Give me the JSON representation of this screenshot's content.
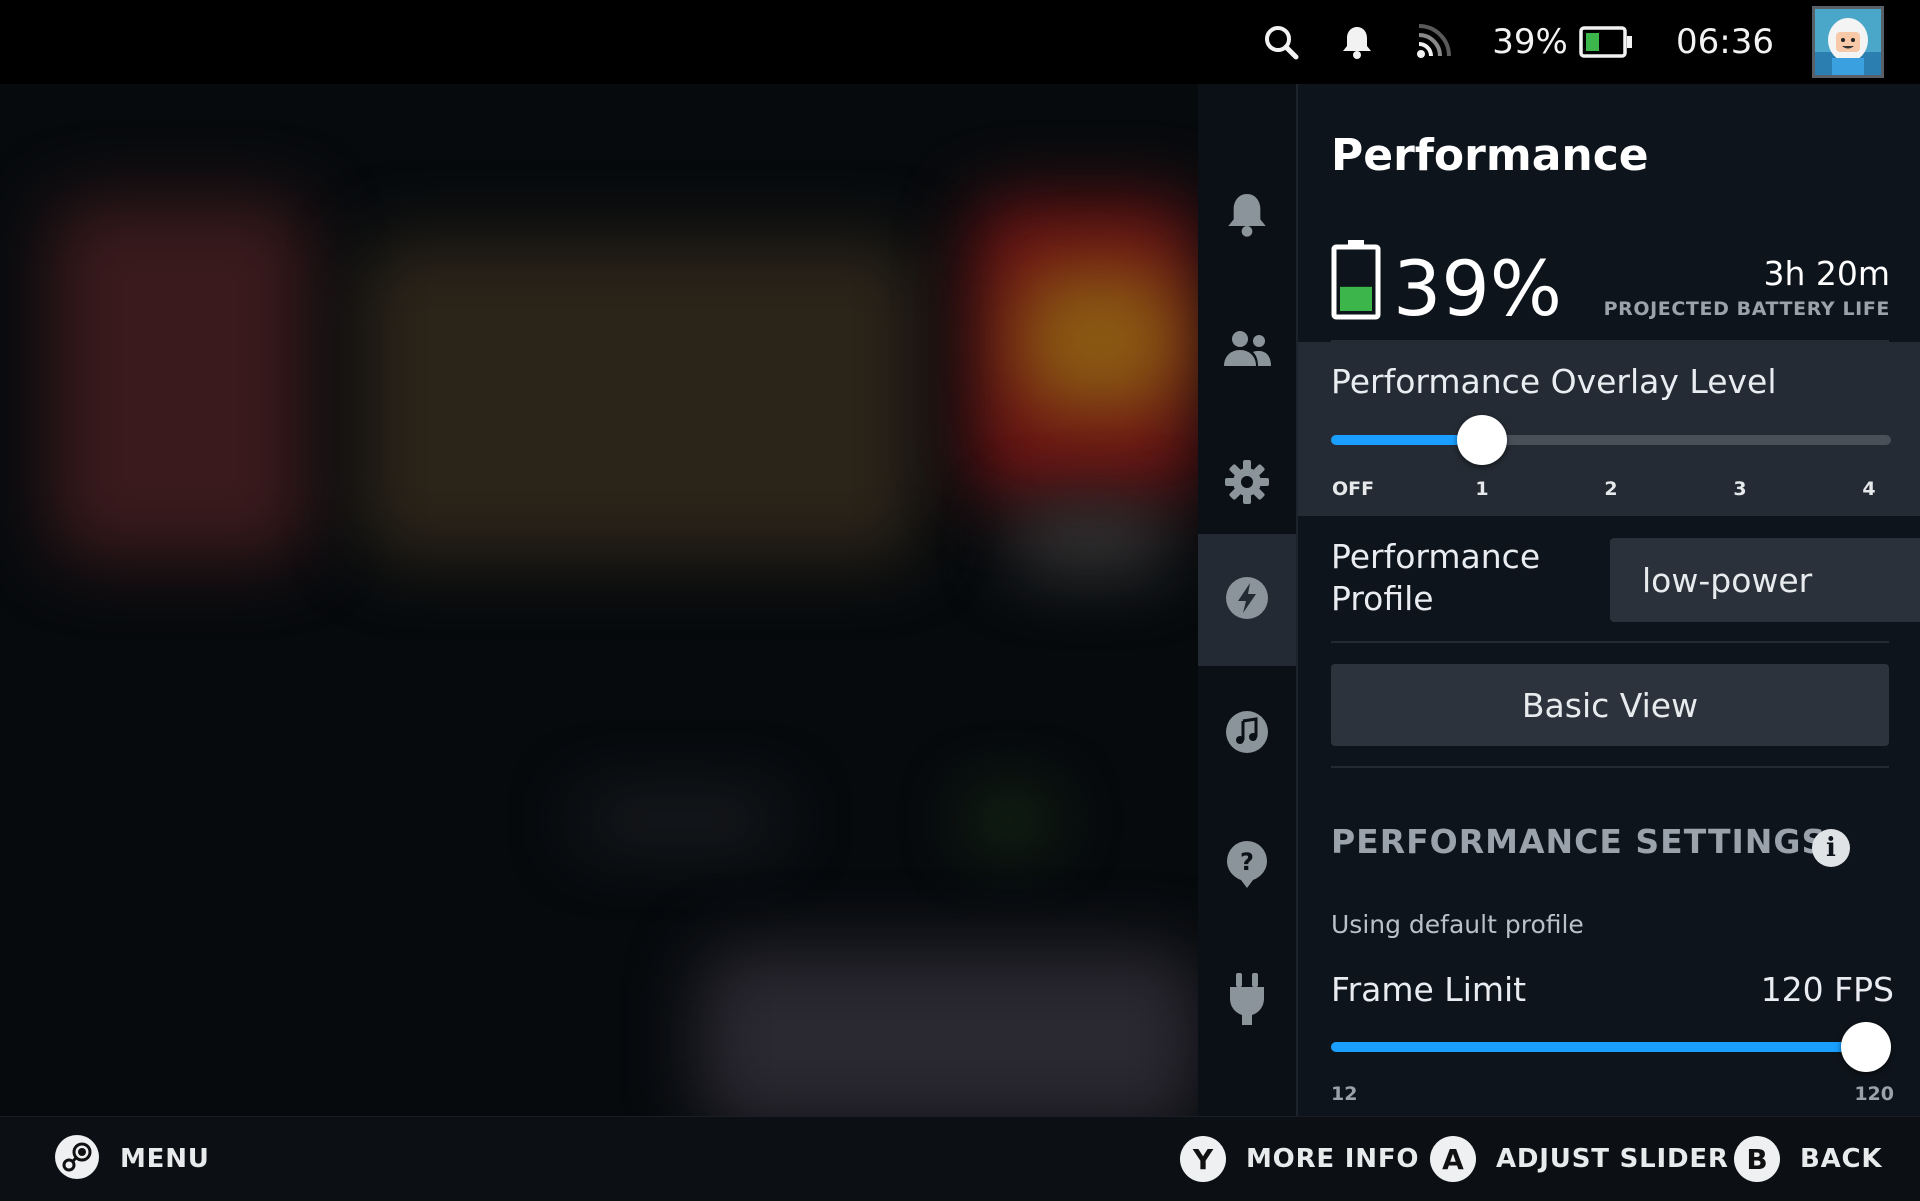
{
  "topbar": {
    "battery_percent": "39%",
    "time": "06:36",
    "icons": [
      "search-icon",
      "bell-icon",
      "wifi-icon",
      "battery-icon",
      "avatar"
    ]
  },
  "tabs": [
    {
      "name": "notifications",
      "icon": "bell-icon",
      "active": false
    },
    {
      "name": "friends",
      "icon": "friends-icon",
      "active": false
    },
    {
      "name": "settings",
      "icon": "gear-icon",
      "active": false
    },
    {
      "name": "performance",
      "icon": "lightning-icon",
      "active": true
    },
    {
      "name": "music",
      "icon": "music-icon",
      "active": false
    },
    {
      "name": "help",
      "icon": "help-icon",
      "active": false
    },
    {
      "name": "power",
      "icon": "plug-icon",
      "active": false
    }
  ],
  "panel": {
    "title": "Performance",
    "battery_percent": "39%",
    "battery_level": 0.39,
    "projected_time": "3h 20m",
    "projected_label": "PROJECTED BATTERY LIFE",
    "overlay": {
      "label": "Performance Overlay Level",
      "ticks": [
        "OFF",
        "1",
        "2",
        "3",
        "4"
      ],
      "value_index": 1
    },
    "profile": {
      "label_line1": "Performance",
      "label_line2": "Profile",
      "value": "low-power"
    },
    "basic_view_label": "Basic View",
    "settings_heading": "PERFORMANCE SETTINGS",
    "info_glyph": "i",
    "default_profile_text": "Using default profile",
    "frame_limit": {
      "label": "Frame Limit",
      "value": "120 FPS",
      "min_label": "12",
      "max_label": "120",
      "fraction": 1.0
    }
  },
  "bottombar": {
    "menu_label": "MENU",
    "y_glyph": "Y",
    "y_label": "MORE INFO",
    "a_glyph": "A",
    "a_label": "ADJUST SLIDER",
    "b_glyph": "B",
    "b_label": "BACK"
  },
  "colors": {
    "accent": "#1a9fff",
    "panel_bg": "#0e141b",
    "battery_green": "#3cb54a"
  }
}
